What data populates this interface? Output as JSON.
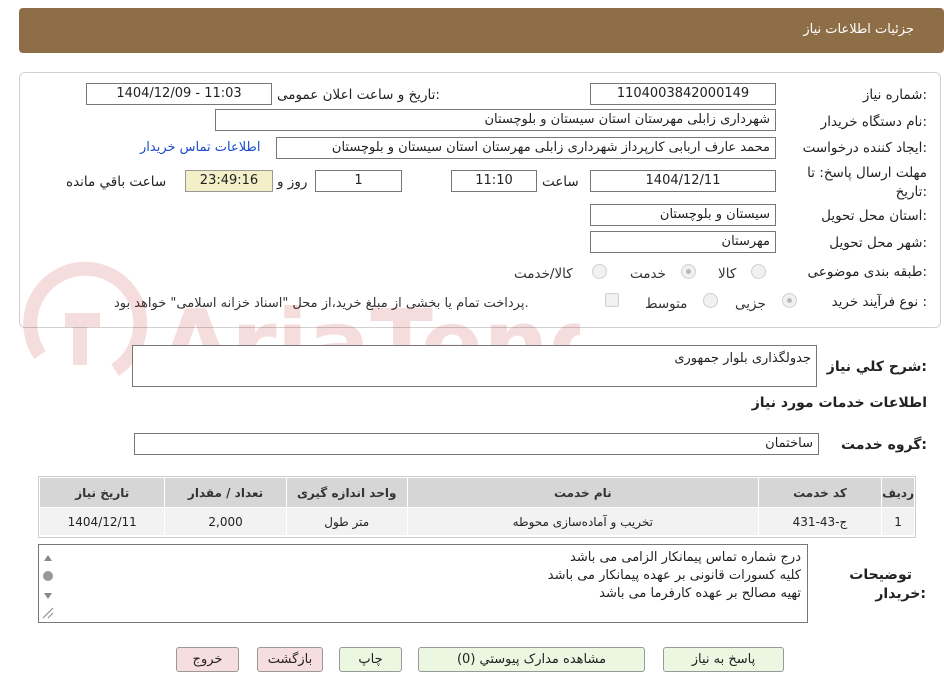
{
  "title": "جزئیات اطلاعات نیاز",
  "fields": {
    "need_number_label": "شماره نیاز:",
    "need_number": "1104003842000149",
    "announce_label": "تاریخ و ساعت اعلان عمومی:",
    "announce_value": "1404/12/09 - 11:03",
    "buyer_org_label": "نام دستگاه خریدار:",
    "buyer_org": "شهرداری زابلی مهرستان استان سیستان و بلوچستان",
    "requester_label": "ایجاد کننده درخواست:",
    "requester": "محمد عارف اربابی کارپرداز شهرداری زابلی مهرستان استان سیستان و بلوچستان",
    "contact_link": "اطلاعات تماس خریدار",
    "deadline_label_1": "مهلت ارسال پاسخ: تا",
    "deadline_label_2": "تاریخ:",
    "deadline_date": "1404/12/11",
    "time_label": "ساعت",
    "deadline_time": "11:10",
    "days_value": "1",
    "days_label": "روز و",
    "remaining_time": "23:49:16",
    "remaining_label": "ساعت باقي مانده",
    "province_label": "استان محل تحویل:",
    "province": "سیستان و بلوچستان",
    "city_label": "شهر محل تحویل:",
    "city": "مهرستان",
    "category_label": "طبقه بندی موضوعی:",
    "category_options": [
      "کالا",
      "خدمت",
      "کالا/خدمت"
    ],
    "category_selected": "خدمت",
    "purchase_type_label": "نوع فرآیند خرید :",
    "purchase_options": [
      "جزیی",
      "متوسط"
    ],
    "purchase_selected": "جزیی",
    "payment_note": "پرداخت تمام یا بخشی از مبلغ خرید،از محل \"اسناد خزانه اسلامی\" خواهد بود."
  },
  "description": {
    "label": "شرح کلي نياز:",
    "value": "جدولگذاری بلوار جمهوری"
  },
  "services_heading": "اطلاعات خدمات مورد نیاز",
  "service_group": {
    "label": "گروه خدمت:",
    "value": "ساختمان"
  },
  "table": {
    "headers": [
      "ردیف",
      "کد خدمت",
      "نام خدمت",
      "واحد اندازه گیری",
      "تعداد / مقدار",
      "تاریخ نیاز"
    ],
    "rows": [
      [
        "1",
        "ج-43-431",
        "تخریب و آماده‌سازی محوطه",
        "متر طول",
        "2,000",
        "1404/12/11"
      ]
    ]
  },
  "notes": {
    "label_1": "توضیحات",
    "label_2": "خریدار:",
    "lines": [
      "درج شماره تماس پیمانکار الزامی می باشد",
      "کلیه کسورات قانونی بر عهده پیمانکار می باشد",
      "تهیه مصالح بر عهده کارفرما می باشد"
    ]
  },
  "buttons": {
    "reply": "پاسخ به نیاز",
    "attachments": "مشاهده مدارک پیوستي (0)",
    "print": "چاپ",
    "back": "بازگشت",
    "exit": "خروج"
  },
  "colors": {
    "titlebar": "#8e6e46",
    "link": "#1a4cc8",
    "remaining_bg": "#f3f0c9",
    "button_green": "#ecf7e2",
    "button_pink": "#f6dede"
  }
}
